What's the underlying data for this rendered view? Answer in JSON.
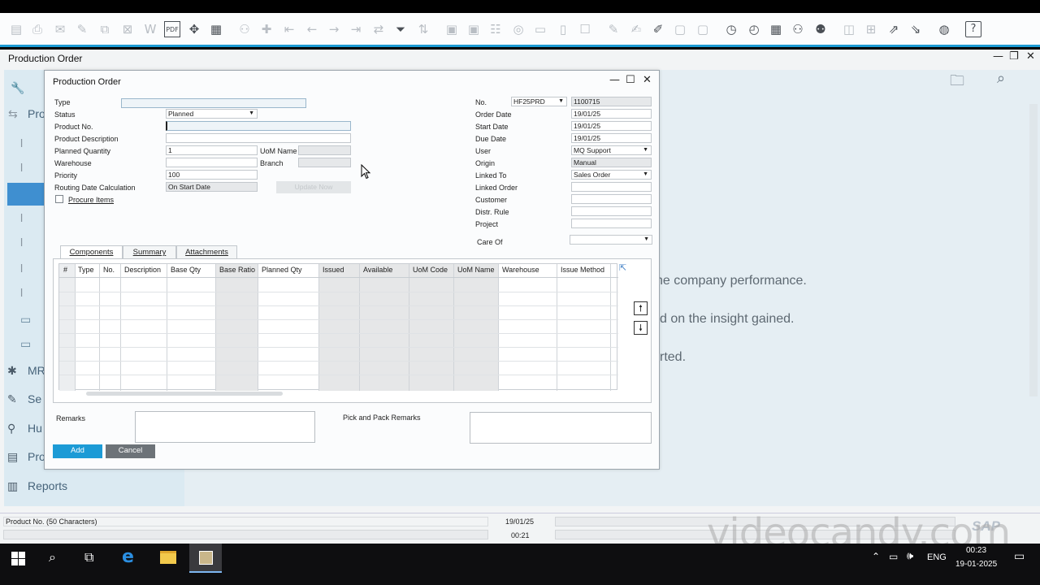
{
  "toolbar": {
    "icons": [
      "preview-icon",
      "print-icon",
      "email-icon",
      "send-icon",
      "copy-icon",
      "close-doc-icon",
      "word-icon",
      "pdf-icon",
      "move-icon",
      "layout-icon",
      "filter-people-icon",
      "add-icon",
      "first-record-icon",
      "previous-record-icon",
      "next-record-icon",
      "last-record-icon",
      "refresh-icon",
      "filter-icon",
      "sort-icon",
      "base-doc-icon",
      "target-doc-icon",
      "doc-flow-icon",
      "gross-profit-icon",
      "payment-icon",
      "edit-icon",
      "approval-icon",
      "messages-icon",
      "chat-icon",
      "alerts-icon",
      "timer-icon",
      "calendar-icon",
      "users-icon",
      "user-icon",
      "settings-icon",
      "window-icon",
      "chart-icon",
      "form-settings-icon",
      "web-icon",
      "help-icon"
    ],
    "help_label": "?"
  },
  "main_window": {
    "title": "Production Order",
    "cockpit_lines": [
      "he company performance.",
      "d on the insight gained.",
      "rted."
    ]
  },
  "sidebar": {
    "items": [
      {
        "label": "Pro"
      },
      {
        "label": "MR"
      },
      {
        "label": "Se"
      },
      {
        "label": "Hu"
      },
      {
        "label": "Pro"
      },
      {
        "label": "Reports"
      }
    ]
  },
  "dialog": {
    "title": "Production Order",
    "left_fields": {
      "type_label": "Type",
      "type_value": "",
      "status_label": "Status",
      "status_value": "Planned",
      "product_no_label": "Product No.",
      "product_no_value": "",
      "product_desc_label": "Product Description",
      "product_desc_value": "",
      "planned_qty_label": "Planned Quantity",
      "planned_qty_value": "1",
      "uom_name_label": "UoM Name",
      "uom_name_value": "",
      "warehouse_label": "Warehouse",
      "warehouse_value": "",
      "branch_label": "Branch",
      "branch_value": "",
      "priority_label": "Priority",
      "priority_value": "100",
      "routing_label": "Routing Date Calculation",
      "routing_value": "On Start Date",
      "update_now_label": "Update Now",
      "procure_items_label": "Procure Items",
      "procure_items_checked": false
    },
    "right_fields": {
      "no_label": "No.",
      "series_value": "HF25PRD",
      "no_value": "1100715",
      "order_date_label": "Order Date",
      "order_date_value": "19/01/25",
      "start_date_label": "Start Date",
      "start_date_value": "19/01/25",
      "due_date_label": "Due Date",
      "due_date_value": "19/01/25",
      "user_label": "User",
      "user_value": "MQ Support",
      "origin_label": "Origin",
      "origin_value": "Manual",
      "linked_to_label": "Linked To",
      "linked_to_value": "Sales Order",
      "linked_order_label": "Linked Order",
      "linked_order_value": "",
      "customer_label": "Customer",
      "customer_value": "",
      "distr_rule_label": "Distr. Rule",
      "distr_rule_value": "",
      "project_label": "Project",
      "project_value": "",
      "care_of_label": "Care Of",
      "care_of_value": ""
    },
    "tabs": [
      {
        "label": "Components",
        "active": true
      },
      {
        "label": "Summary",
        "active": false
      },
      {
        "label": "Attachments",
        "active": false
      }
    ],
    "grid_columns": [
      "#",
      "Type",
      "No.",
      "Description",
      "Base Qty",
      "Base Ratio",
      "Planned Qty",
      "Issued",
      "Available",
      "UoM Code",
      "UoM Name",
      "Warehouse",
      "Issue Method"
    ],
    "remarks_label": "Remarks",
    "pick_pack_label": "Pick and Pack Remarks",
    "add_label": "Add",
    "cancel_label": "Cancel",
    "add_color": "#1c9bd6",
    "cancel_color": "#6d7378"
  },
  "status_bar": {
    "message": "Product No. (50 Characters)",
    "date": "19/01/25",
    "time": "00:21"
  },
  "watermark": "videocandy.com",
  "taskbar": {
    "language": "ENG",
    "clock_time": "00:23",
    "clock_date": "19-01-2025"
  }
}
